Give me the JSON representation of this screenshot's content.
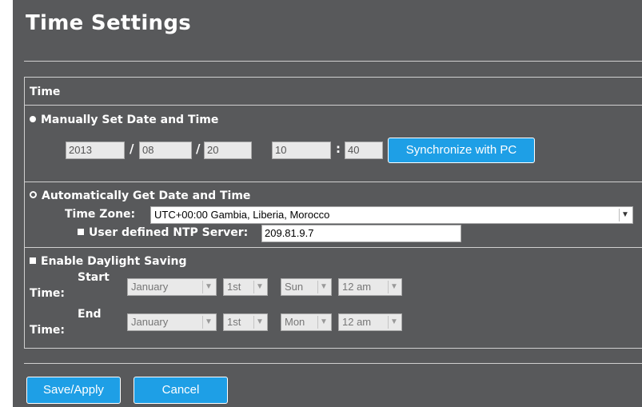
{
  "page": {
    "title": "Time Settings"
  },
  "section": {
    "header": "Time"
  },
  "manual": {
    "label": "Manually Set Date and Time",
    "year": "2013",
    "month": "08",
    "day": "20",
    "hour": "10",
    "minute": "40",
    "sep_slash": "/",
    "sep_colon": ":",
    "sync_button": "Synchronize with PC"
  },
  "auto": {
    "label": "Automatically Get Date and Time",
    "timezone_label": "Time Zone:",
    "timezone_value": "UTC+00:00 Gambia, Liberia, Morocco",
    "ntp_label": "User defined NTP Server:",
    "ntp_value": "209.81.9.7"
  },
  "dst": {
    "label": "Enable Daylight Saving",
    "start_label_1": "Start",
    "start_label_2": "Time:",
    "end_label_1": "End",
    "end_label_2": "Time:",
    "start": {
      "month": "January",
      "week": "1st",
      "day": "Sun",
      "hour": "12 am"
    },
    "end": {
      "month": "January",
      "week": "1st",
      "day": "Mon",
      "hour": "12 am"
    }
  },
  "actions": {
    "save": "Save/Apply",
    "cancel": "Cancel"
  },
  "icons": {
    "dropdown": "chevron-down-icon"
  }
}
